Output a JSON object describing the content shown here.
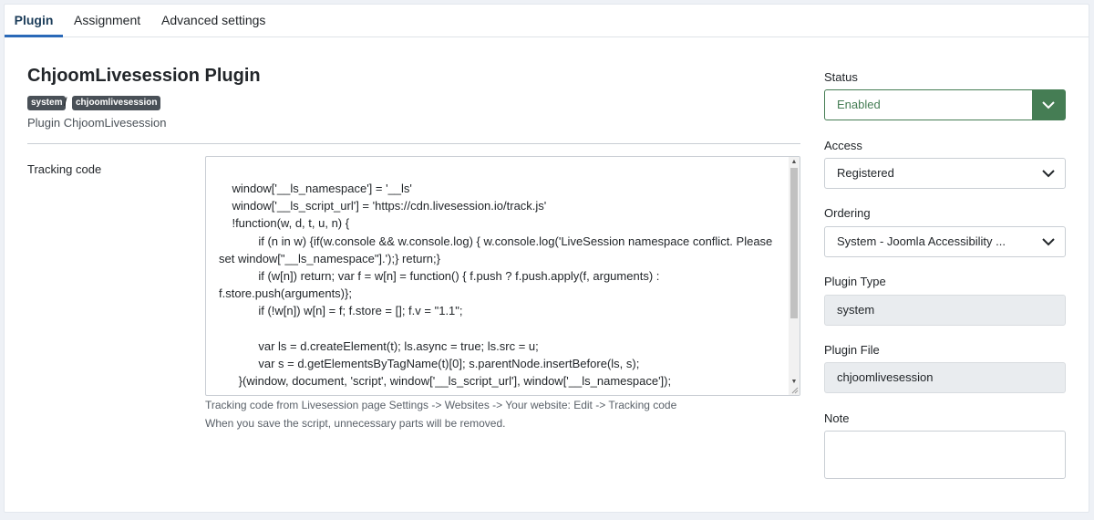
{
  "tabs": [
    {
      "label": "Plugin"
    },
    {
      "label": "Assignment"
    },
    {
      "label": "Advanced settings"
    }
  ],
  "plugin": {
    "title": "ChjoomLivesession Plugin",
    "badge_group": "system",
    "badge_separator": "/",
    "badge_element": "chjoomlivesession",
    "description": "Plugin ChjoomLivesession"
  },
  "tracking": {
    "label": "Tracking code",
    "code": "    window['__ls_namespace'] = '__ls'\n    window['__ls_script_url'] = 'https://cdn.livesession.io/track.js'\n    !function(w, d, t, u, n) {\n            if (n in w) {if(w.console && w.console.log) { w.console.log('LiveSession namespace conflict. Please set window[\"__ls_namespace\"].');} return;}\n            if (w[n]) return; var f = w[n] = function() { f.push ? f.push.apply(f, arguments) : f.store.push(arguments)};\n            if (!w[n]) w[n] = f; f.store = []; f.v = \"1.1\";\n\n            var ls = d.createElement(t); ls.async = true; ls.src = u;\n            var s = d.getElementsByTagName(t)[0]; s.parentNode.insertBefore(ls, s);\n      }(window, document, 'script', window['__ls_script_url'], window['__ls_namespace']);",
    "hint1": "Tracking code from Livesession page Settings -> Websites -> Your website: Edit -> Tracking code",
    "hint2": "When you save the script, unnecessary parts will be removed."
  },
  "sidebar": {
    "status_label": "Status",
    "status_value": "Enabled",
    "access_label": "Access",
    "access_value": "Registered",
    "ordering_label": "Ordering",
    "ordering_value": "System - Joomla Accessibility ...",
    "type_label": "Plugin Type",
    "type_value": "system",
    "file_label": "Plugin File",
    "file_value": "chjoomlivesession",
    "note_label": "Note",
    "note_value": ""
  },
  "colors": {
    "accent_blue": "#2a69b8",
    "status_green": "#457d54",
    "badge_bg": "#495057"
  }
}
